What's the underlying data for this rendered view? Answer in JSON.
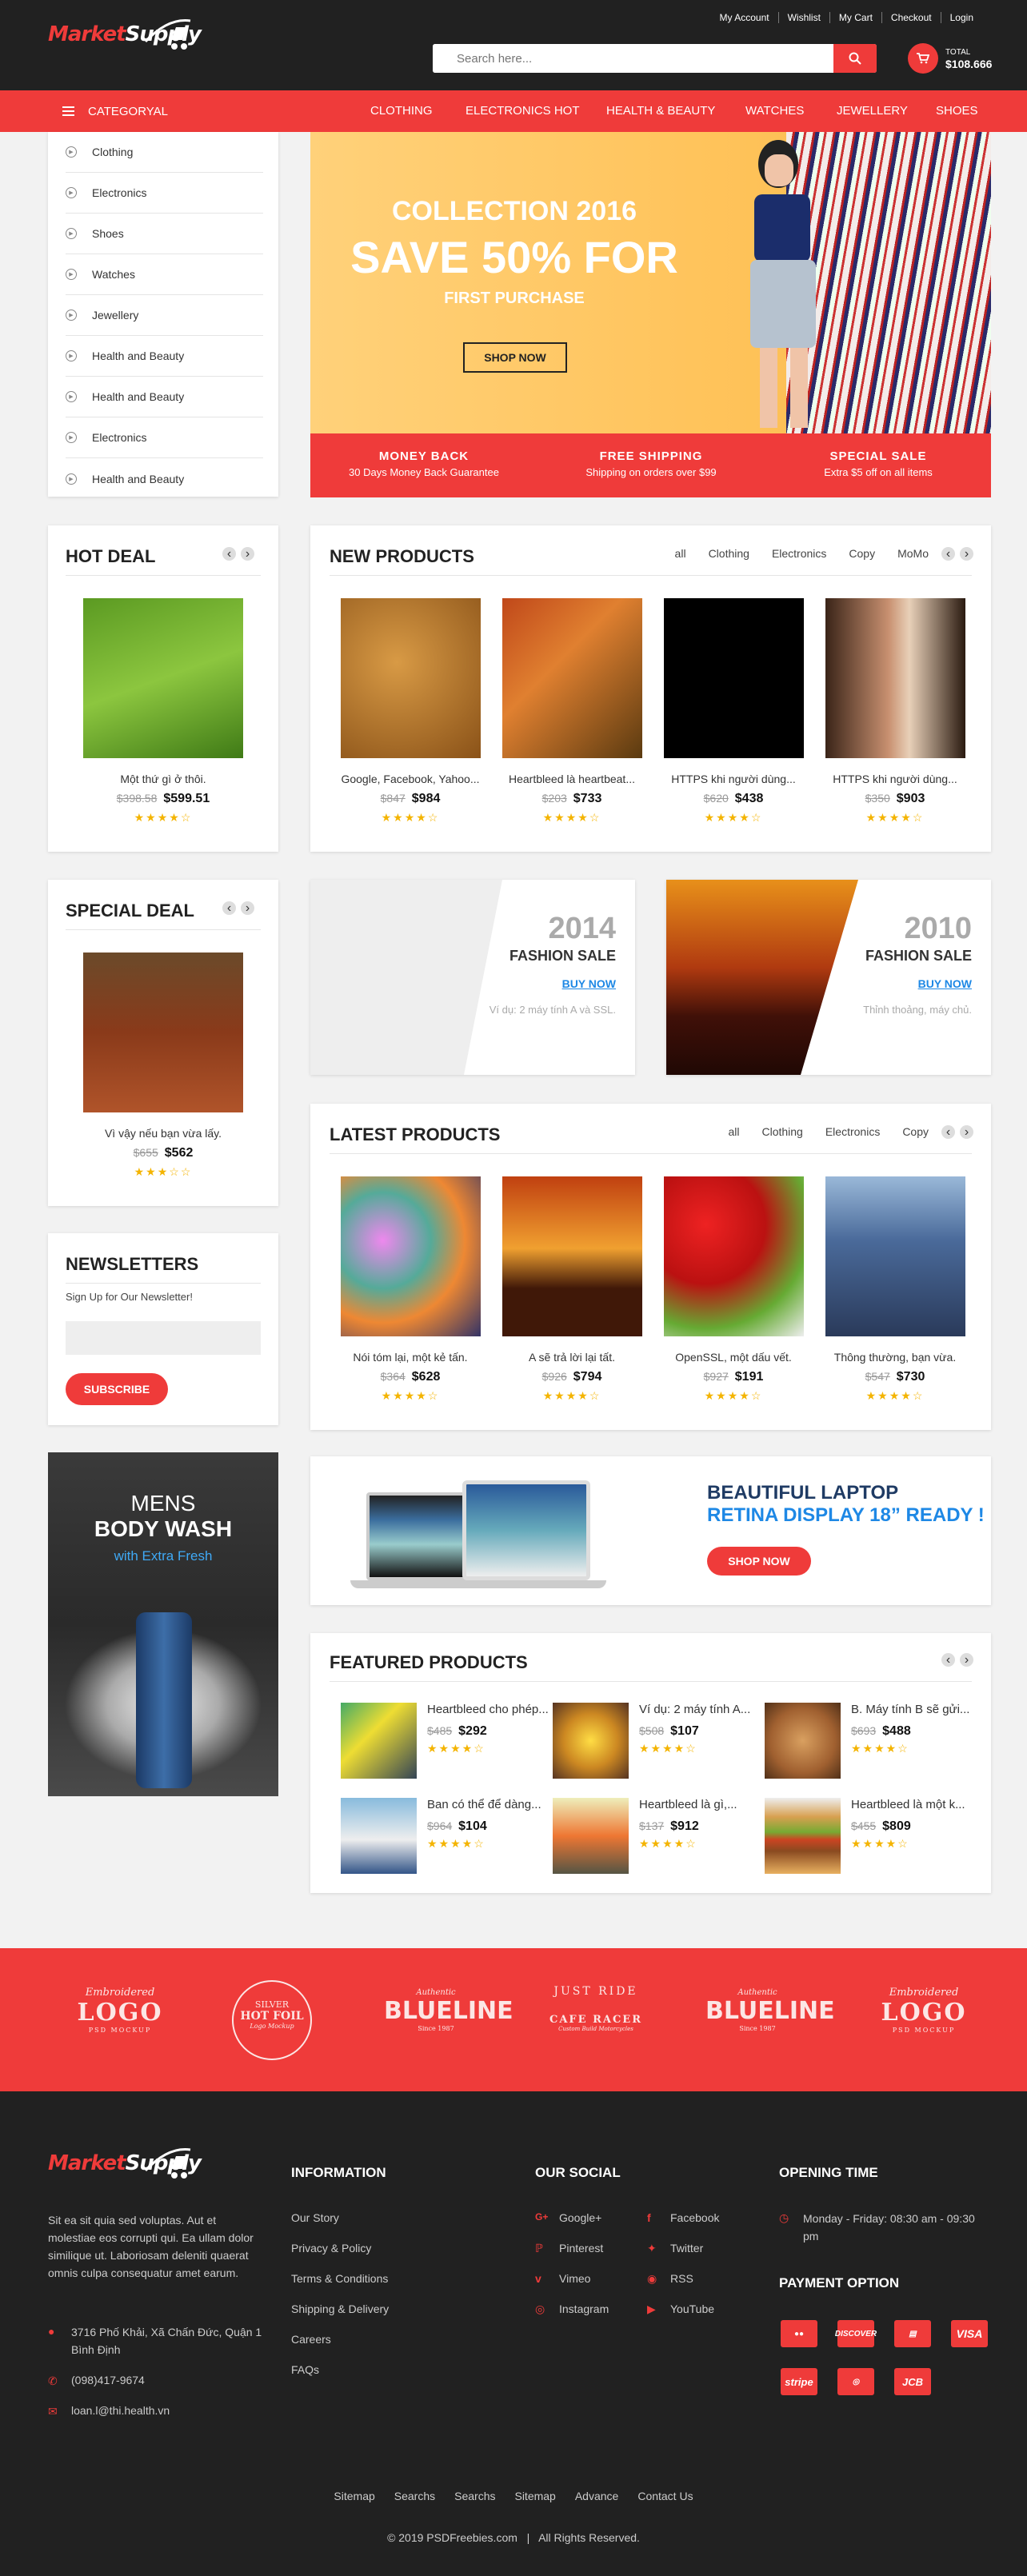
{
  "brand": {
    "part1": "Market",
    "part2": "Supply"
  },
  "top_links": [
    "My Account",
    "Wishlist",
    "My Cart",
    "Checkout",
    "Login"
  ],
  "search": {
    "placeholder": "Search here..."
  },
  "cart": {
    "label": "TOTAL",
    "total": "$108.666"
  },
  "nav": {
    "category_label": "CATEGORYAL",
    "items": [
      "CLOTHING",
      "ELECTRONICS HOT",
      "HEALTH & BEAUTY",
      "WATCHES",
      "JEWELLERY",
      "SHOES"
    ]
  },
  "sidebar_categories": [
    "Clothing",
    "Electronics",
    "Shoes",
    "Watches",
    "Jewellery",
    "Health and Beauty",
    "Health and Beauty",
    "Electronics",
    "Health and Beauty"
  ],
  "hero": {
    "line1": "COLLECTION 2016",
    "line2": "SAVE 50% FOR",
    "line3": "FIRST PURCHASE",
    "button": "SHOP NOW",
    "features": [
      {
        "title": "MONEY BACK",
        "text": "30 Days Money Back Guarantee"
      },
      {
        "title": "FREE SHIPPING",
        "text": "Shipping on orders over $99"
      },
      {
        "title": "SPECIAL SALE",
        "text": "Extra $5 off on all items"
      }
    ]
  },
  "hot_deal": {
    "title": "HOT DEAL",
    "name": "Một thứ gì ở thôi.",
    "old": "$398.58",
    "new": "$599.51",
    "rating": 4
  },
  "new_products": {
    "title": "NEW PRODUCTS",
    "filters": [
      "all",
      "Clothing",
      "Electronics",
      "Copy",
      "MoMo"
    ],
    "items": [
      {
        "name": "Google, Facebook, Yahoo...",
        "old": "$847",
        "new": "$984",
        "rating": 4
      },
      {
        "name": "Heartbleed là heartbeat...",
        "old": "$203",
        "new": "$733",
        "rating": 4
      },
      {
        "name": "HTTPS khi người dùng...",
        "old": "$620",
        "new": "$438",
        "rating": 4
      },
      {
        "name": "HTTPS khi người dùng...",
        "old": "$350",
        "new": "$903",
        "rating": 4
      }
    ]
  },
  "special_deal": {
    "title": "SPECIAL DEAL",
    "name": "Vì vậy nếu bạn vừa lấy.",
    "old": "$655",
    "new": "$562",
    "rating": 3
  },
  "fashion": [
    {
      "year": "2014",
      "label": "FASHION SALE",
      "link": "BUY NOW",
      "text": "Ví dụ: 2 máy tính A và SSL."
    },
    {
      "year": "2010",
      "label": "FASHION SALE",
      "link": "BUY NOW",
      "text": "Thỉnh thoảng, máy chủ."
    }
  ],
  "latest_products": {
    "title": "LATEST PRODUCTS",
    "filters": [
      "all",
      "Clothing",
      "Electronics",
      "Copy"
    ],
    "items": [
      {
        "name": "Nói tóm lại, một kẻ tấn.",
        "old": "$364",
        "new": "$628",
        "rating": 4
      },
      {
        "name": "A sẽ trả lời lại tất.",
        "old": "$926",
        "new": "$794",
        "rating": 4
      },
      {
        "name": "OpenSSL, một dấu vết.",
        "old": "$927",
        "new": "$191",
        "rating": 4
      },
      {
        "name": "Thông thường, bạn vừa.",
        "old": "$547",
        "new": "$730",
        "rating": 4
      }
    ]
  },
  "newsletter": {
    "title": "NEWSLETTERS",
    "subtitle": "Sign Up for Our Newsletter!",
    "button": "SUBSCRIBE"
  },
  "banner": {
    "line1": "MENS",
    "line2": "BODY WASH",
    "line3": "with Extra Fresh"
  },
  "laptop": {
    "line1": "BEAUTIFUL LAPTOP",
    "line2": "RETINA DISPLAY 18” READY !",
    "button": "SHOP NOW"
  },
  "featured": {
    "title": "FEATURED PRODUCTS",
    "items": [
      {
        "name": "Heartbleed cho phép...",
        "old": "$485",
        "new": "$292",
        "rating": 4
      },
      {
        "name": "Ví dụ: 2 máy tính A...",
        "old": "$508",
        "new": "$107",
        "rating": 4
      },
      {
        "name": "B. Máy tính B sẽ gửi...",
        "old": "$693",
        "new": "$488",
        "rating": 4
      },
      {
        "name": "Ban có thể để dàng...",
        "old": "$964",
        "new": "$104",
        "rating": 4
      },
      {
        "name": "Heartbleed là gì,...",
        "old": "$137",
        "new": "$912",
        "rating": 4
      },
      {
        "name": "Heartbleed là một k...",
        "old": "$455",
        "new": "$809",
        "rating": 4
      }
    ]
  },
  "brands": [
    {
      "top": "Embroidered",
      "main": "LOGO",
      "sub": "PSD MOCKUP"
    },
    {
      "top": "SILVER",
      "main": "HOT FOIL",
      "sub": "Logo Mockup"
    },
    {
      "top": "Authentic",
      "main": "BLUELINE",
      "sub": "Since 1987"
    },
    {
      "top": "JUST RIDE",
      "main": "CAFE RACER",
      "sub": "Custom Build Motorcycles"
    },
    {
      "top": "Authentic",
      "main": "BLUELINE",
      "sub": "Since 1987"
    },
    {
      "top": "Embroidered",
      "main": "LOGO",
      "sub": "PSD MOCKUP"
    }
  ],
  "footer": {
    "about": "Sit ea sit quia sed voluptas. Aut et molestiae eos corrupti qui. Ea ullam dolor similique ut. Laboriosam deleniti quaerat omnis culpa consequatur amet earum.",
    "address": "3716 Phố Khải, Xã Chấn Đức, Quận 1 Bình Định",
    "phone": "(098)417-9674",
    "email": "loan.l@thi.health.vn",
    "information_title": "INFORMATION",
    "information": [
      "Our Story",
      "Privacy & Policy",
      "Terms & Conditions",
      "Shipping & Delivery",
      "Careers",
      "FAQs"
    ],
    "social_title": "OUR SOCIAL",
    "social_left": [
      "Google+",
      "Pinterest",
      "Vimeo",
      "Instagram"
    ],
    "social_right": [
      "Facebook",
      "Twitter",
      "RSS",
      "YouTube"
    ],
    "opening_title": "OPENING TIME",
    "opening": "Monday - Friday: 08:30 am - 09:30 pm",
    "payment_title": "PAYMENT OPTION",
    "payments": [
      "MC",
      "DISCOVER",
      "AMEX",
      "VISA",
      "stripe",
      "MC",
      "JCB"
    ],
    "bottom_links": [
      "Sitemap",
      "Searchs",
      "Searchs",
      "Sitemap",
      "Advance",
      "Contact Us"
    ],
    "copyright": "© 2019 PSDFreebies.com   |   All Rights Reserved."
  },
  "colors": {
    "accent": "#ef3b3a",
    "dark": "#212121",
    "blue": "#1e88e5"
  }
}
